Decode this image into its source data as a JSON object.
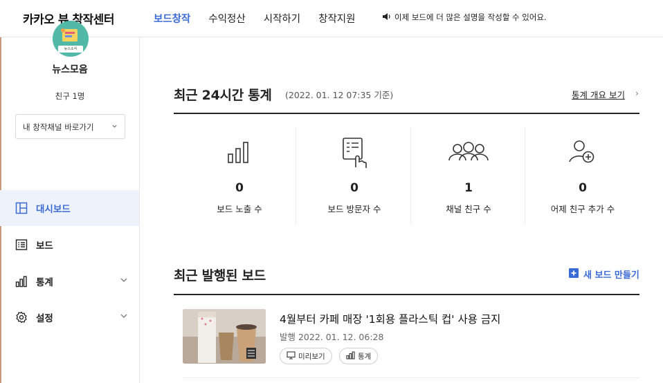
{
  "header": {
    "logo": "카카오 뷰 창작센터",
    "nav": [
      "보드창작",
      "수익정산",
      "시작하기",
      "창작지원"
    ],
    "notice": "이제 보드에 더 많은 설명을 작성할 수 있어요."
  },
  "sidebar": {
    "avatar_text": "뉴스소식",
    "profile_name": "뉴스모음",
    "friends": "친구 1명",
    "channel_select": "내 창작채널 바로가기",
    "menu": [
      {
        "label": "대시보드",
        "icon": "dashboard-icon"
      },
      {
        "label": "보드",
        "icon": "board-list-icon"
      },
      {
        "label": "통계",
        "icon": "bar-chart-icon"
      },
      {
        "label": "설정",
        "icon": "gear-icon"
      }
    ]
  },
  "stats": {
    "title": "최근 24시간 통계",
    "date": "(2022. 01. 12 07:35 기준)",
    "overview_link": "통계 개요 보기",
    "items": [
      {
        "value": "0",
        "label": "보드 노출 수",
        "icon": "bar-chart-icon"
      },
      {
        "value": "0",
        "label": "보드 방문자 수",
        "icon": "touch-board-icon"
      },
      {
        "value": "1",
        "label": "채널 친구 수",
        "icon": "people-icon"
      },
      {
        "value": "0",
        "label": "어제 친구 추가 수",
        "icon": "add-user-icon"
      }
    ]
  },
  "recent": {
    "title": "최근 발행된 보드",
    "new_board": "새 보드 만들기",
    "post": {
      "title": "4월부터 카페 매장 '1회용 플라스틱 컵' 사용 금지",
      "date": "발행 2022. 01. 12. 06:28",
      "preview": "미리보기",
      "stats": "통계"
    }
  },
  "colors": {
    "accent": "#3a6ad6",
    "active_bg": "#eef2fa"
  }
}
